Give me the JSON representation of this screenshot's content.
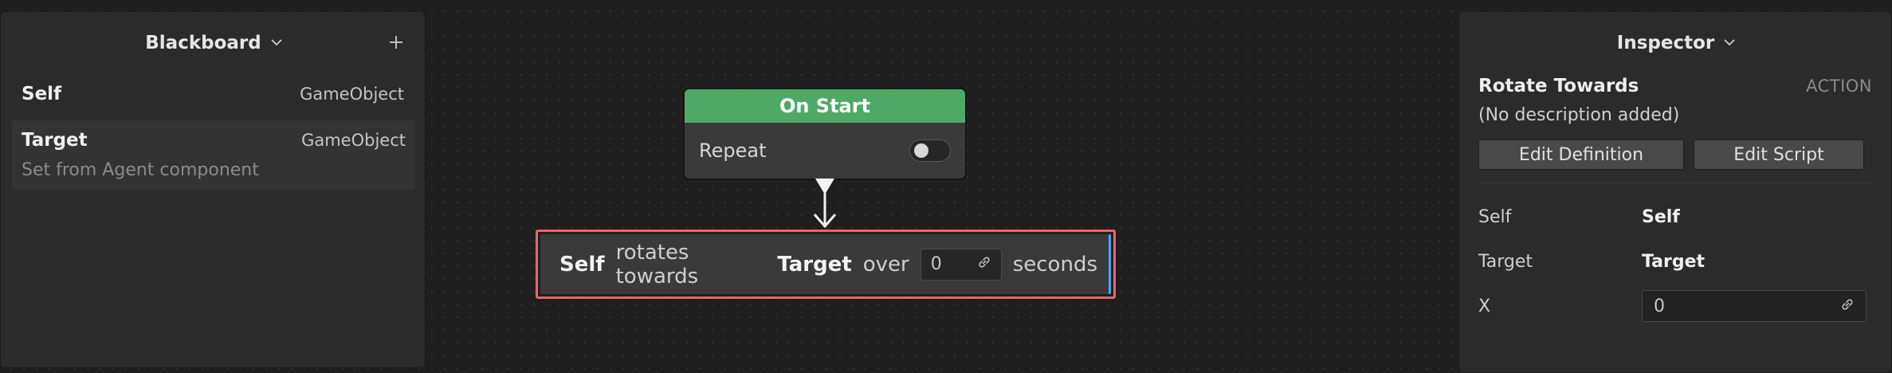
{
  "blackboard": {
    "title": "Blackboard",
    "variables": [
      {
        "name": "Self",
        "type": "GameObject"
      },
      {
        "name": "Target",
        "type": "GameObject",
        "note": "Set from Agent component"
      }
    ]
  },
  "graph": {
    "on_start": {
      "title": "On Start",
      "repeat_label": "Repeat",
      "repeat_enabled": false,
      "header_color": "#4fa966"
    },
    "action": {
      "subject": "Self",
      "verb": "rotates towards",
      "target": "Target",
      "over": "over",
      "duration_value": "0",
      "unit": "seconds"
    }
  },
  "inspector": {
    "title": "Inspector",
    "node_name": "Rotate Towards",
    "node_kind": "ACTION",
    "description": "(No description added)",
    "edit_definition_label": "Edit Definition",
    "edit_script_label": "Edit Script",
    "properties": [
      {
        "label": "Self",
        "value": "Self"
      },
      {
        "label": "Target",
        "value": "Target"
      },
      {
        "label": "X",
        "value": "0"
      }
    ]
  },
  "colors": {
    "selection_outline": "#e8666a",
    "accent_blue": "#4aa3ff"
  }
}
